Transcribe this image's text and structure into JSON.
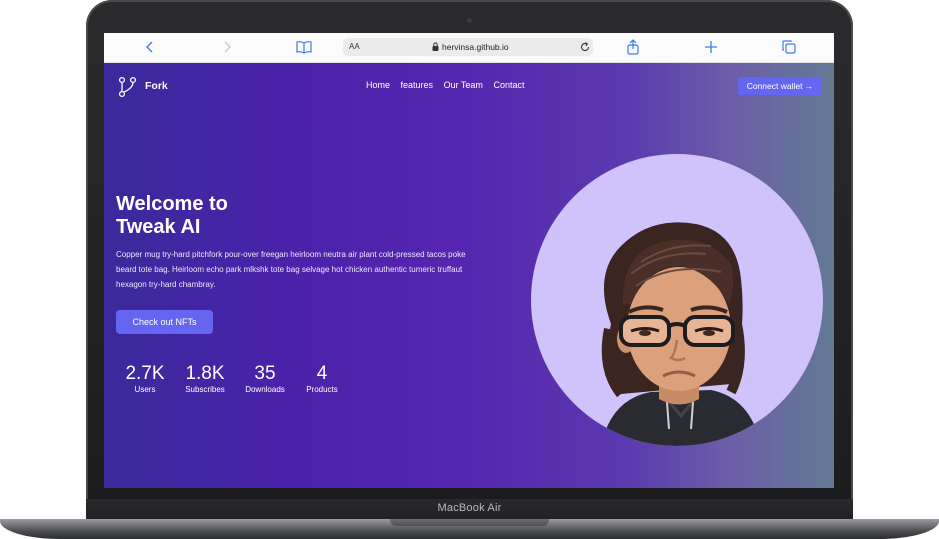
{
  "device": {
    "label": "MacBook Air"
  },
  "browser": {
    "text_size_label": "AA",
    "url": "hervinsa.github.io"
  },
  "site": {
    "logo": "Fork",
    "nav": [
      "Home",
      "features",
      "Our Team",
      "Contact"
    ],
    "connect_button": "Connect wallet →",
    "hero": {
      "title_line1": "Welcome to",
      "title_line2": "Tweak AI",
      "text": "Copper mug try-hard pitchfork pour-over freegan heirloom neutra air plant cold-pressed tacos poke beard tote bag. Heirloom echo park mlkshk tote bag selvage hot chicken authentic tumeric truffaut hexagon try-hard chambray.",
      "cta": "Check out NFTs"
    },
    "stats": [
      {
        "value": "2.7K",
        "label": "Users"
      },
      {
        "value": "1.8K",
        "label": "Subscribes"
      },
      {
        "value": "35",
        "label": "Downloads"
      },
      {
        "value": "4",
        "label": "Products"
      }
    ],
    "colors": {
      "accent": "#6466f1",
      "avatar_bg": "#d0c2fb",
      "gradient_start": "#3a2a9b",
      "gradient_end": "#627a94"
    }
  }
}
